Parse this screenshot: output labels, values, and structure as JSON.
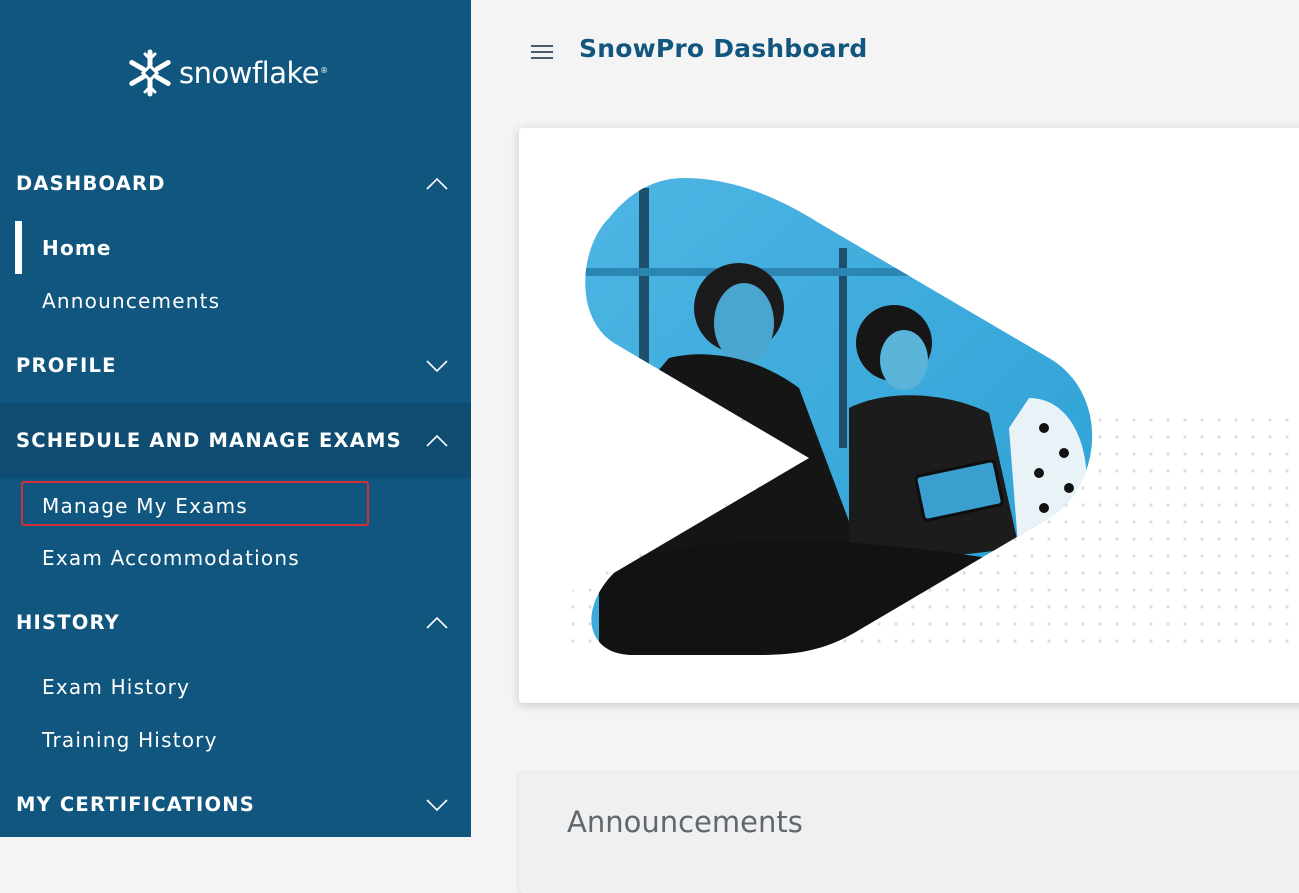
{
  "brand": {
    "name": "snowflake",
    "reg": "®",
    "color": "#11567f"
  },
  "header": {
    "title": "SnowPro Dashboard",
    "menu_icon": "hamburger-menu-icon"
  },
  "sidebar": {
    "sections": [
      {
        "label": "DASHBOARD",
        "expanded": true,
        "items": [
          "Home",
          "Announcements"
        ]
      },
      {
        "label": "PROFILE",
        "expanded": false,
        "items": []
      },
      {
        "label": "SCHEDULE AND MANAGE EXAMS",
        "expanded": true,
        "items": [
          "Manage My Exams",
          "Exam Accommodations"
        ]
      },
      {
        "label": "HISTORY",
        "expanded": true,
        "items": [
          "Exam History",
          "Training History"
        ]
      },
      {
        "label": "MY CERTIFICATIONS",
        "expanded": false,
        "items": []
      }
    ],
    "current_item": "Home",
    "highlighted_item": "Manage My Exams"
  },
  "main": {
    "hero_image": "students-with-tablet-photo",
    "announcements_title": "Announcements"
  },
  "colors": {
    "sidebar_bg": "#11567f",
    "active_section_bg": "#0e4c72",
    "highlight_border": "#d12f3a",
    "title": "#12567f"
  }
}
